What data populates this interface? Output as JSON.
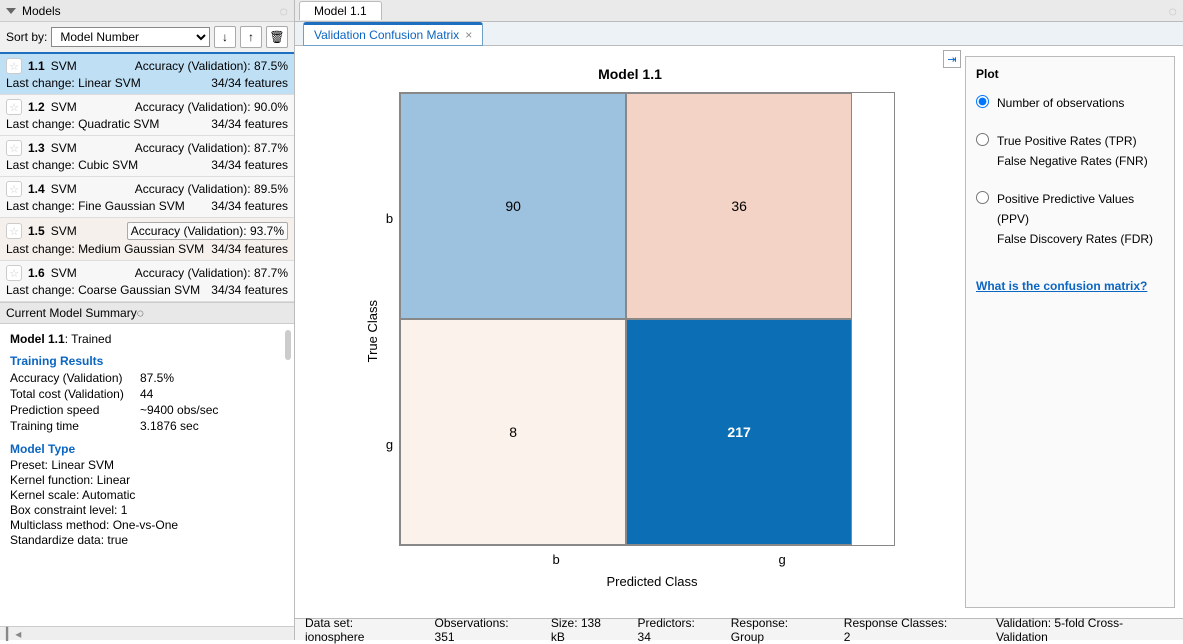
{
  "panel": {
    "models_title": "Models",
    "summary_title": "Current Model Summary",
    "sort_label": "Sort by:",
    "sort_value": "Model Number"
  },
  "models": [
    {
      "id": "1.1",
      "type": "SVM",
      "acc_label": "Accuracy (Validation):",
      "acc": "87.5%",
      "lc_label": "Last change:",
      "lc": "Linear SVM",
      "feat": "34/34 features",
      "selected": true
    },
    {
      "id": "1.2",
      "type": "SVM",
      "acc_label": "Accuracy (Validation):",
      "acc": "90.0%",
      "lc_label": "Last change:",
      "lc": "Quadratic SVM",
      "feat": "34/34 features",
      "selected": false
    },
    {
      "id": "1.3",
      "type": "SVM",
      "acc_label": "Accuracy (Validation):",
      "acc": "87.7%",
      "lc_label": "Last change:",
      "lc": "Cubic SVM",
      "feat": "34/34 features",
      "selected": false
    },
    {
      "id": "1.4",
      "type": "SVM",
      "acc_label": "Accuracy (Validation):",
      "acc": "89.5%",
      "lc_label": "Last change:",
      "lc": "Fine Gaussian SVM",
      "feat": "34/34 features",
      "selected": false
    },
    {
      "id": "1.5",
      "type": "SVM",
      "acc_label": "Accuracy (Validation):",
      "acc": "93.7%",
      "lc_label": "Last change:",
      "lc": "Medium Gaussian SVM",
      "feat": "34/34 features",
      "selected": false,
      "boxed": true
    },
    {
      "id": "1.6",
      "type": "SVM",
      "acc_label": "Accuracy (Validation):",
      "acc": "87.7%",
      "lc_label": "Last change:",
      "lc": "Coarse Gaussian SVM",
      "feat": "34/34 features",
      "selected": false
    }
  ],
  "summary": {
    "heading": "Model 1.1",
    "status": ": Trained",
    "tr_title": "Training Results",
    "acc_k": "Accuracy (Validation)",
    "acc_v": "87.5%",
    "cost_k": "Total cost (Validation)",
    "cost_v": "44",
    "speed_k": "Prediction speed",
    "speed_v": "~9400 obs/sec",
    "time_k": "Training time",
    "time_v": "3.1876 sec",
    "mt_title": "Model Type",
    "preset": "Preset: Linear SVM",
    "kernel": "Kernel function: Linear",
    "kscale": "Kernel scale: Automatic",
    "box": "Box constraint level: 1",
    "mc": "Multiclass method: One-vs-One",
    "std": "Standardize data: true"
  },
  "tabs": {
    "main": "Model 1.1",
    "sub": "Validation Confusion Matrix"
  },
  "chart_data": {
    "type": "heatmap",
    "title": "Model 1.1",
    "xlabel": "Predicted Class",
    "ylabel": "True Class",
    "x_categories": [
      "b",
      "g"
    ],
    "y_categories": [
      "b",
      "g"
    ],
    "values": [
      [
        90,
        36
      ],
      [
        8,
        217
      ]
    ],
    "colors": [
      [
        "#9dc2df",
        "#f2d3c5"
      ],
      [
        "#fbf2eb",
        "#0c6fb6"
      ]
    ]
  },
  "plot_opts": {
    "title": "Plot",
    "opt1": "Number of observations",
    "opt2a": "True Positive Rates (TPR)",
    "opt2b": "False Negative Rates (FNR)",
    "opt3a": "Positive Predictive Values (PPV)",
    "opt3b": "False Discovery Rates (FDR)",
    "help": "What is the confusion matrix?"
  },
  "status": {
    "dataset": "Data set: ionosphere",
    "obs": "Observations: 351",
    "size": "Size: 138 kB",
    "pred": "Predictors: 34",
    "resp": "Response: Group",
    "classes": "Response Classes: 2",
    "val": "Validation: 5-fold Cross-Validation"
  }
}
